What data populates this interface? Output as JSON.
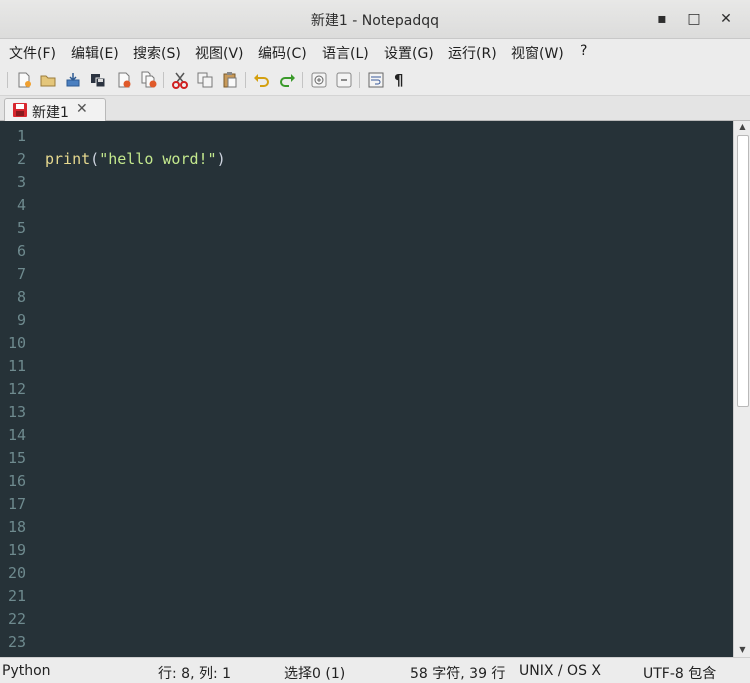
{
  "window": {
    "title": "新建1 - Notepadqq",
    "minimize_glyph": "▪",
    "maximize_glyph": "□",
    "close_glyph": "✕"
  },
  "menu": {
    "items": [
      {
        "label": "文件(F)"
      },
      {
        "label": "编辑(E)"
      },
      {
        "label": "搜索(S)"
      },
      {
        "label": "视图(V)"
      },
      {
        "label": "编码(C)"
      },
      {
        "label": "语言(L)"
      },
      {
        "label": "设置(G)"
      },
      {
        "label": "运行(R)"
      },
      {
        "label": "视窗(W)"
      },
      {
        "label": "?"
      }
    ]
  },
  "toolbar": {
    "buttons": [
      {
        "icon": "new-file-icon"
      },
      {
        "icon": "open-folder-icon"
      },
      {
        "icon": "save-icon"
      },
      {
        "icon": "save-all-icon"
      },
      {
        "icon": "close-file-icon"
      },
      {
        "icon": "close-all-icon"
      },
      {
        "icon": "cut-icon"
      },
      {
        "icon": "copy-icon"
      },
      {
        "icon": "paste-icon"
      },
      {
        "icon": "undo-icon"
      },
      {
        "icon": "redo-icon"
      },
      {
        "icon": "zoom-in-icon"
      },
      {
        "icon": "zoom-out-icon"
      },
      {
        "icon": "word-wrap-icon"
      },
      {
        "icon": "show-all-chars-icon"
      }
    ],
    "pilcrow": "¶"
  },
  "tabs": [
    {
      "label": "新建1",
      "close": "✕",
      "modified": true
    }
  ],
  "editor": {
    "line_numbers": [
      "1",
      "2",
      "3",
      "4",
      "5",
      "6",
      "7",
      "8",
      "9",
      "10",
      "11",
      "12",
      "13",
      "14",
      "15",
      "16",
      "17",
      "18",
      "19",
      "20",
      "21",
      "22",
      "23"
    ],
    "code": {
      "line": 2,
      "func": "print",
      "open_paren": "(",
      "string": "\"hello word!\"",
      "close_paren": ")"
    },
    "colors": {
      "background": "#263238",
      "line_number": "#6e8a8e",
      "function": "#e6d98f",
      "string": "#c3e88d"
    }
  },
  "status": {
    "language": "Python",
    "position": "行:  8, 列:  1",
    "selection": "选择0 (1)",
    "counts": "58 字符, 39 行",
    "eol": "UNIX / OS X",
    "encoding": "UTF-8 包含"
  }
}
